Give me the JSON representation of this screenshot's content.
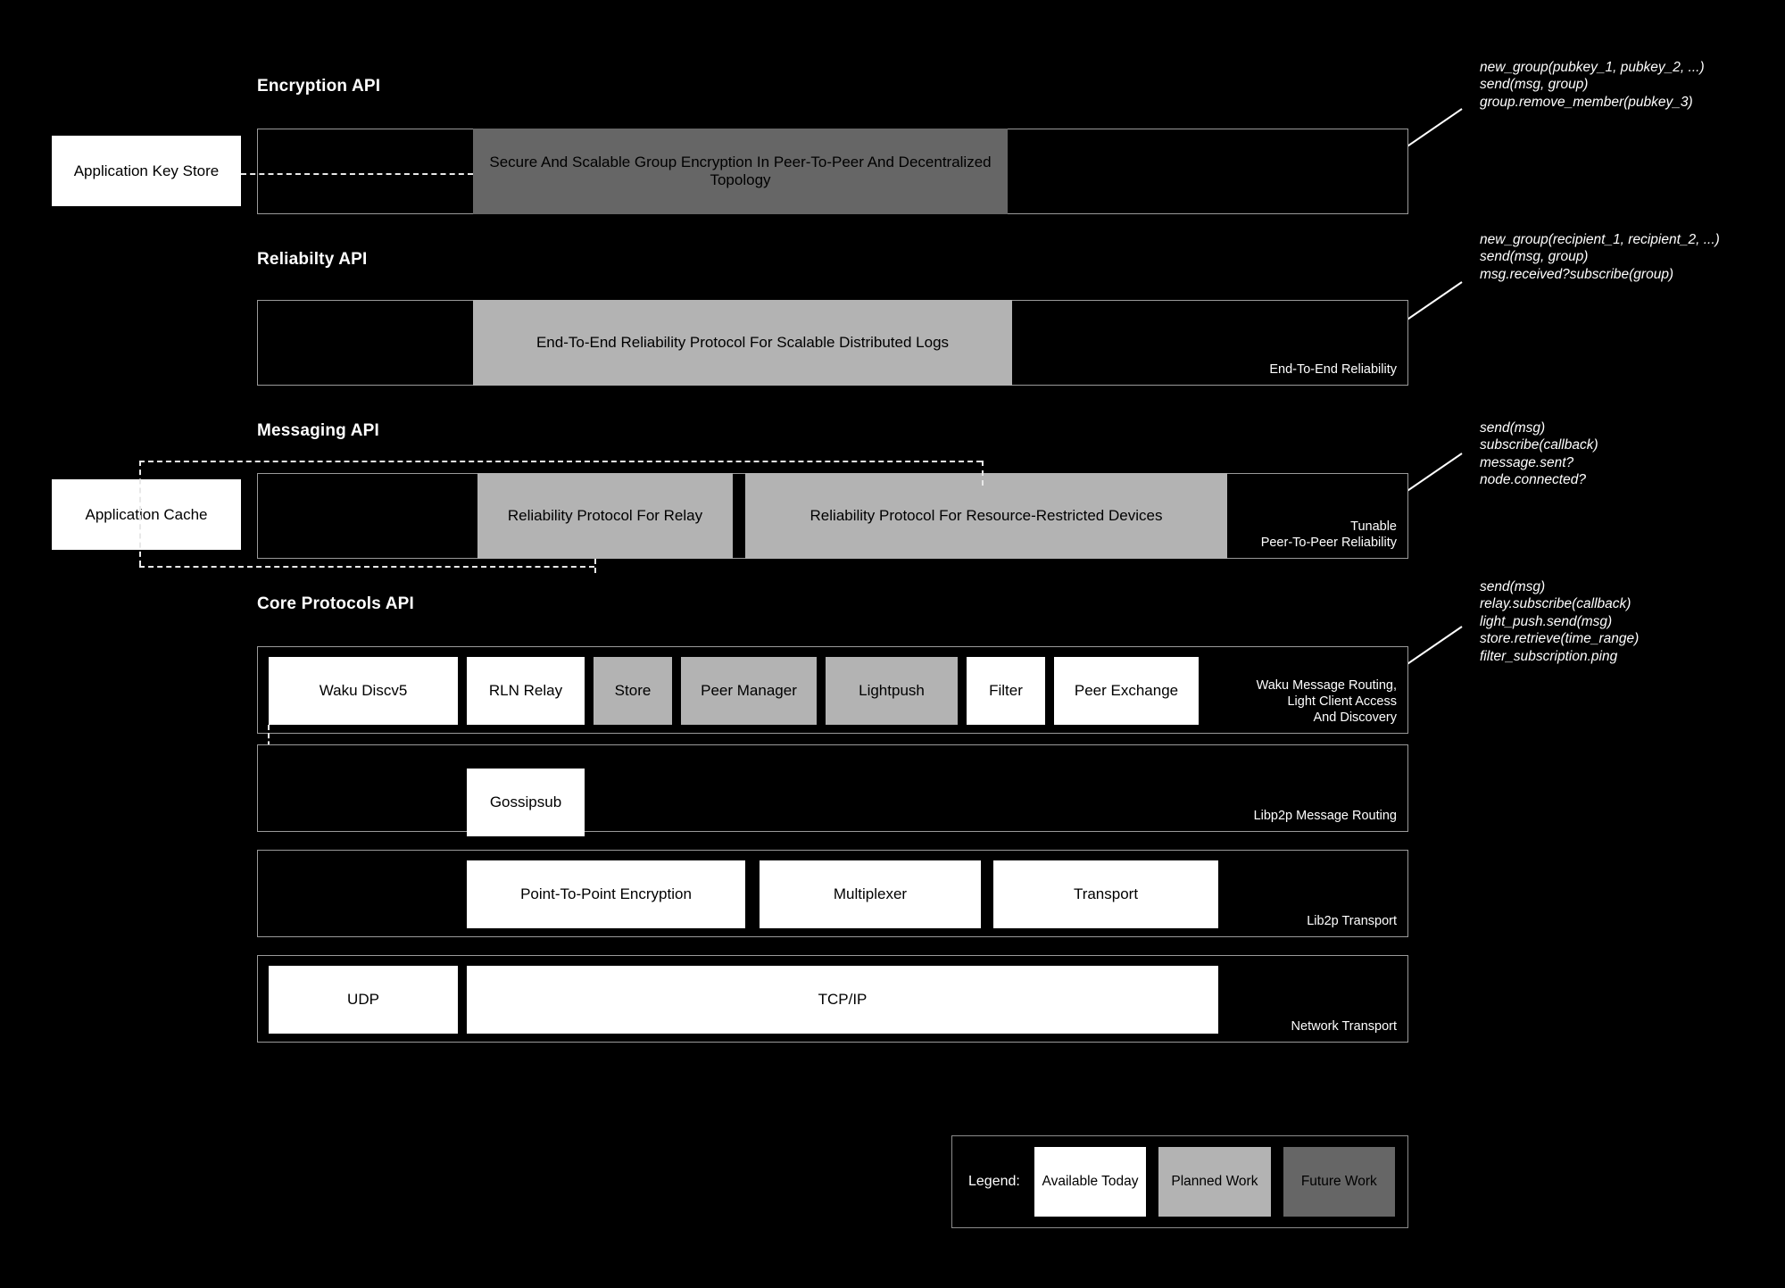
{
  "theme": {
    "background": "#000000",
    "available_today": "#ffffff",
    "planned_work": "#b3b3b3",
    "future_work": "#666666",
    "border": "#9a9a9a",
    "text_light": "#ffffff",
    "text_dark": "#000000"
  },
  "sections": [
    {
      "id": "encryption",
      "title": "Encryption API",
      "callout": "new_group(pubkey_1, pubkey_2, ...)\nsend(msg, group)\ngroup.remove_member(pubkey_3)",
      "callout_lines": [
        "new_group(pubkey_1, pubkey_2, ...)",
        "send(msg, group)",
        "group.remove_member(pubkey_3)"
      ],
      "row_label": "",
      "tiles": [
        {
          "label": "Secure And Scalable Group Encryption In Peer-To-Peer And Decentralized Topology",
          "status": "future"
        }
      ]
    },
    {
      "id": "reliability",
      "title": "Reliabilty API",
      "callout_lines": [
        "new_group(recipient_1, recipient_2, ...)",
        "send(msg, group)",
        "msg.received?subscribe(group)"
      ],
      "row_label": "End-To-End Reliability",
      "tiles": [
        {
          "label": "End-To-End Reliability Protocol For Scalable Distributed Logs",
          "status": "plan"
        }
      ]
    },
    {
      "id": "messaging",
      "title": "Messaging API",
      "callout_lines": [
        "send(msg)",
        "subscribe(callback)",
        "message.sent?",
        "node.connected?"
      ],
      "row_label": "Tunable\nPeer-To-Peer Reliability",
      "tiles": [
        {
          "label": "Reliability Protocol For Relay",
          "status": "plan"
        },
        {
          "label": "Reliability Protocol For Resource-Restricted Devices",
          "status": "plan"
        }
      ]
    },
    {
      "id": "core",
      "title": "Core Protocols API",
      "callout_lines": [
        "send(msg)",
        "relay.subscribe(callback)",
        "light_push.send(msg)",
        "store.retrieve(time_range)",
        "filter_subscription.ping"
      ],
      "row_label": "Waku Message Routing,\nLight Client Access\nAnd Discovery",
      "tiles": [
        {
          "label": "Waku Discv5",
          "status": "avail"
        },
        {
          "label": "RLN Relay",
          "status": "avail"
        },
        {
          "label": "Store",
          "status": "plan"
        },
        {
          "label": "Peer Manager",
          "status": "plan"
        },
        {
          "label": "Lightpush",
          "status": "plan"
        },
        {
          "label": "Filter",
          "status": "avail"
        },
        {
          "label": "Peer Exchange",
          "status": "avail"
        }
      ]
    }
  ],
  "stack_rows": [
    {
      "id": "libp2p-routing",
      "row_label": "Libp2p Message Routing",
      "tiles": [
        {
          "label": "Gossipsub",
          "status": "avail"
        }
      ]
    },
    {
      "id": "libp2p-transport",
      "row_label": "Lib2p Transport",
      "tiles": [
        {
          "label": "Point-To-Point Encryption",
          "status": "avail"
        },
        {
          "label": "Multiplexer",
          "status": "avail"
        },
        {
          "label": "Transport",
          "status": "avail"
        }
      ]
    },
    {
      "id": "network-transport",
      "row_label": "Network Transport",
      "tiles": [
        {
          "label": "UDP",
          "status": "avail"
        },
        {
          "label": "TCP/IP",
          "status": "avail"
        }
      ]
    }
  ],
  "side_boxes": [
    {
      "id": "key-store",
      "label": "Application Key Store"
    },
    {
      "id": "app-cache",
      "label": "Application Cache"
    }
  ],
  "legend": {
    "label": "Legend:",
    "items": [
      {
        "label": "Available Today",
        "status": "avail"
      },
      {
        "label": "Planned Work",
        "status": "plan"
      },
      {
        "label": "Future Work",
        "status": "future"
      }
    ]
  }
}
